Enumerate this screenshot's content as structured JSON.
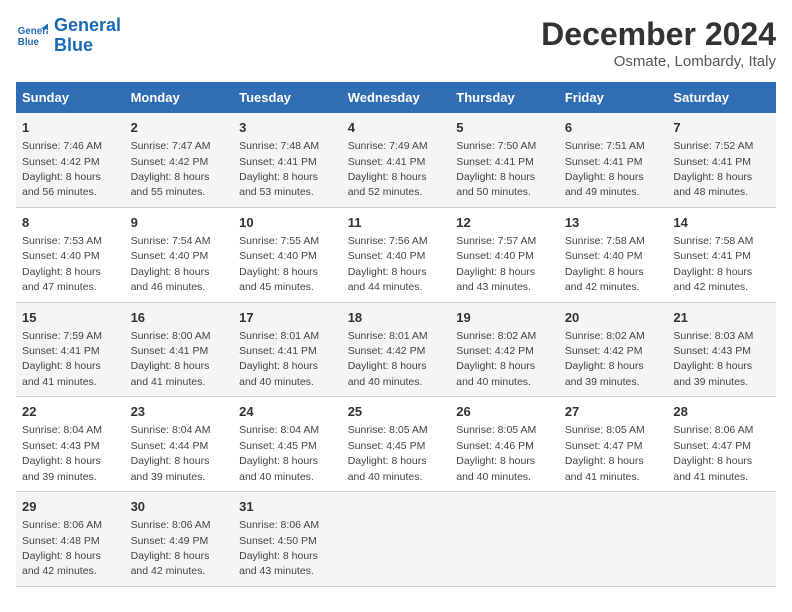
{
  "header": {
    "logo_line1": "General",
    "logo_line2": "Blue",
    "month": "December 2024",
    "location": "Osmate, Lombardy, Italy"
  },
  "columns": [
    "Sunday",
    "Monday",
    "Tuesday",
    "Wednesday",
    "Thursday",
    "Friday",
    "Saturday"
  ],
  "weeks": [
    [
      {
        "day": "1",
        "sunrise": "7:46 AM",
        "sunset": "4:42 PM",
        "daylight": "8 hours and 56 minutes."
      },
      {
        "day": "2",
        "sunrise": "7:47 AM",
        "sunset": "4:42 PM",
        "daylight": "8 hours and 55 minutes."
      },
      {
        "day": "3",
        "sunrise": "7:48 AM",
        "sunset": "4:41 PM",
        "daylight": "8 hours and 53 minutes."
      },
      {
        "day": "4",
        "sunrise": "7:49 AM",
        "sunset": "4:41 PM",
        "daylight": "8 hours and 52 minutes."
      },
      {
        "day": "5",
        "sunrise": "7:50 AM",
        "sunset": "4:41 PM",
        "daylight": "8 hours and 50 minutes."
      },
      {
        "day": "6",
        "sunrise": "7:51 AM",
        "sunset": "4:41 PM",
        "daylight": "8 hours and 49 minutes."
      },
      {
        "day": "7",
        "sunrise": "7:52 AM",
        "sunset": "4:41 PM",
        "daylight": "8 hours and 48 minutes."
      }
    ],
    [
      {
        "day": "8",
        "sunrise": "7:53 AM",
        "sunset": "4:40 PM",
        "daylight": "8 hours and 47 minutes."
      },
      {
        "day": "9",
        "sunrise": "7:54 AM",
        "sunset": "4:40 PM",
        "daylight": "8 hours and 46 minutes."
      },
      {
        "day": "10",
        "sunrise": "7:55 AM",
        "sunset": "4:40 PM",
        "daylight": "8 hours and 45 minutes."
      },
      {
        "day": "11",
        "sunrise": "7:56 AM",
        "sunset": "4:40 PM",
        "daylight": "8 hours and 44 minutes."
      },
      {
        "day": "12",
        "sunrise": "7:57 AM",
        "sunset": "4:40 PM",
        "daylight": "8 hours and 43 minutes."
      },
      {
        "day": "13",
        "sunrise": "7:58 AM",
        "sunset": "4:40 PM",
        "daylight": "8 hours and 42 minutes."
      },
      {
        "day": "14",
        "sunrise": "7:58 AM",
        "sunset": "4:41 PM",
        "daylight": "8 hours and 42 minutes."
      }
    ],
    [
      {
        "day": "15",
        "sunrise": "7:59 AM",
        "sunset": "4:41 PM",
        "daylight": "8 hours and 41 minutes."
      },
      {
        "day": "16",
        "sunrise": "8:00 AM",
        "sunset": "4:41 PM",
        "daylight": "8 hours and 41 minutes."
      },
      {
        "day": "17",
        "sunrise": "8:01 AM",
        "sunset": "4:41 PM",
        "daylight": "8 hours and 40 minutes."
      },
      {
        "day": "18",
        "sunrise": "8:01 AM",
        "sunset": "4:42 PM",
        "daylight": "8 hours and 40 minutes."
      },
      {
        "day": "19",
        "sunrise": "8:02 AM",
        "sunset": "4:42 PM",
        "daylight": "8 hours and 40 minutes."
      },
      {
        "day": "20",
        "sunrise": "8:02 AM",
        "sunset": "4:42 PM",
        "daylight": "8 hours and 39 minutes."
      },
      {
        "day": "21",
        "sunrise": "8:03 AM",
        "sunset": "4:43 PM",
        "daylight": "8 hours and 39 minutes."
      }
    ],
    [
      {
        "day": "22",
        "sunrise": "8:04 AM",
        "sunset": "4:43 PM",
        "daylight": "8 hours and 39 minutes."
      },
      {
        "day": "23",
        "sunrise": "8:04 AM",
        "sunset": "4:44 PM",
        "daylight": "8 hours and 39 minutes."
      },
      {
        "day": "24",
        "sunrise": "8:04 AM",
        "sunset": "4:45 PM",
        "daylight": "8 hours and 40 minutes."
      },
      {
        "day": "25",
        "sunrise": "8:05 AM",
        "sunset": "4:45 PM",
        "daylight": "8 hours and 40 minutes."
      },
      {
        "day": "26",
        "sunrise": "8:05 AM",
        "sunset": "4:46 PM",
        "daylight": "8 hours and 40 minutes."
      },
      {
        "day": "27",
        "sunrise": "8:05 AM",
        "sunset": "4:47 PM",
        "daylight": "8 hours and 41 minutes."
      },
      {
        "day": "28",
        "sunrise": "8:06 AM",
        "sunset": "4:47 PM",
        "daylight": "8 hours and 41 minutes."
      }
    ],
    [
      {
        "day": "29",
        "sunrise": "8:06 AM",
        "sunset": "4:48 PM",
        "daylight": "8 hours and 42 minutes."
      },
      {
        "day": "30",
        "sunrise": "8:06 AM",
        "sunset": "4:49 PM",
        "daylight": "8 hours and 42 minutes."
      },
      {
        "day": "31",
        "sunrise": "8:06 AM",
        "sunset": "4:50 PM",
        "daylight": "8 hours and 43 minutes."
      },
      null,
      null,
      null,
      null
    ]
  ]
}
